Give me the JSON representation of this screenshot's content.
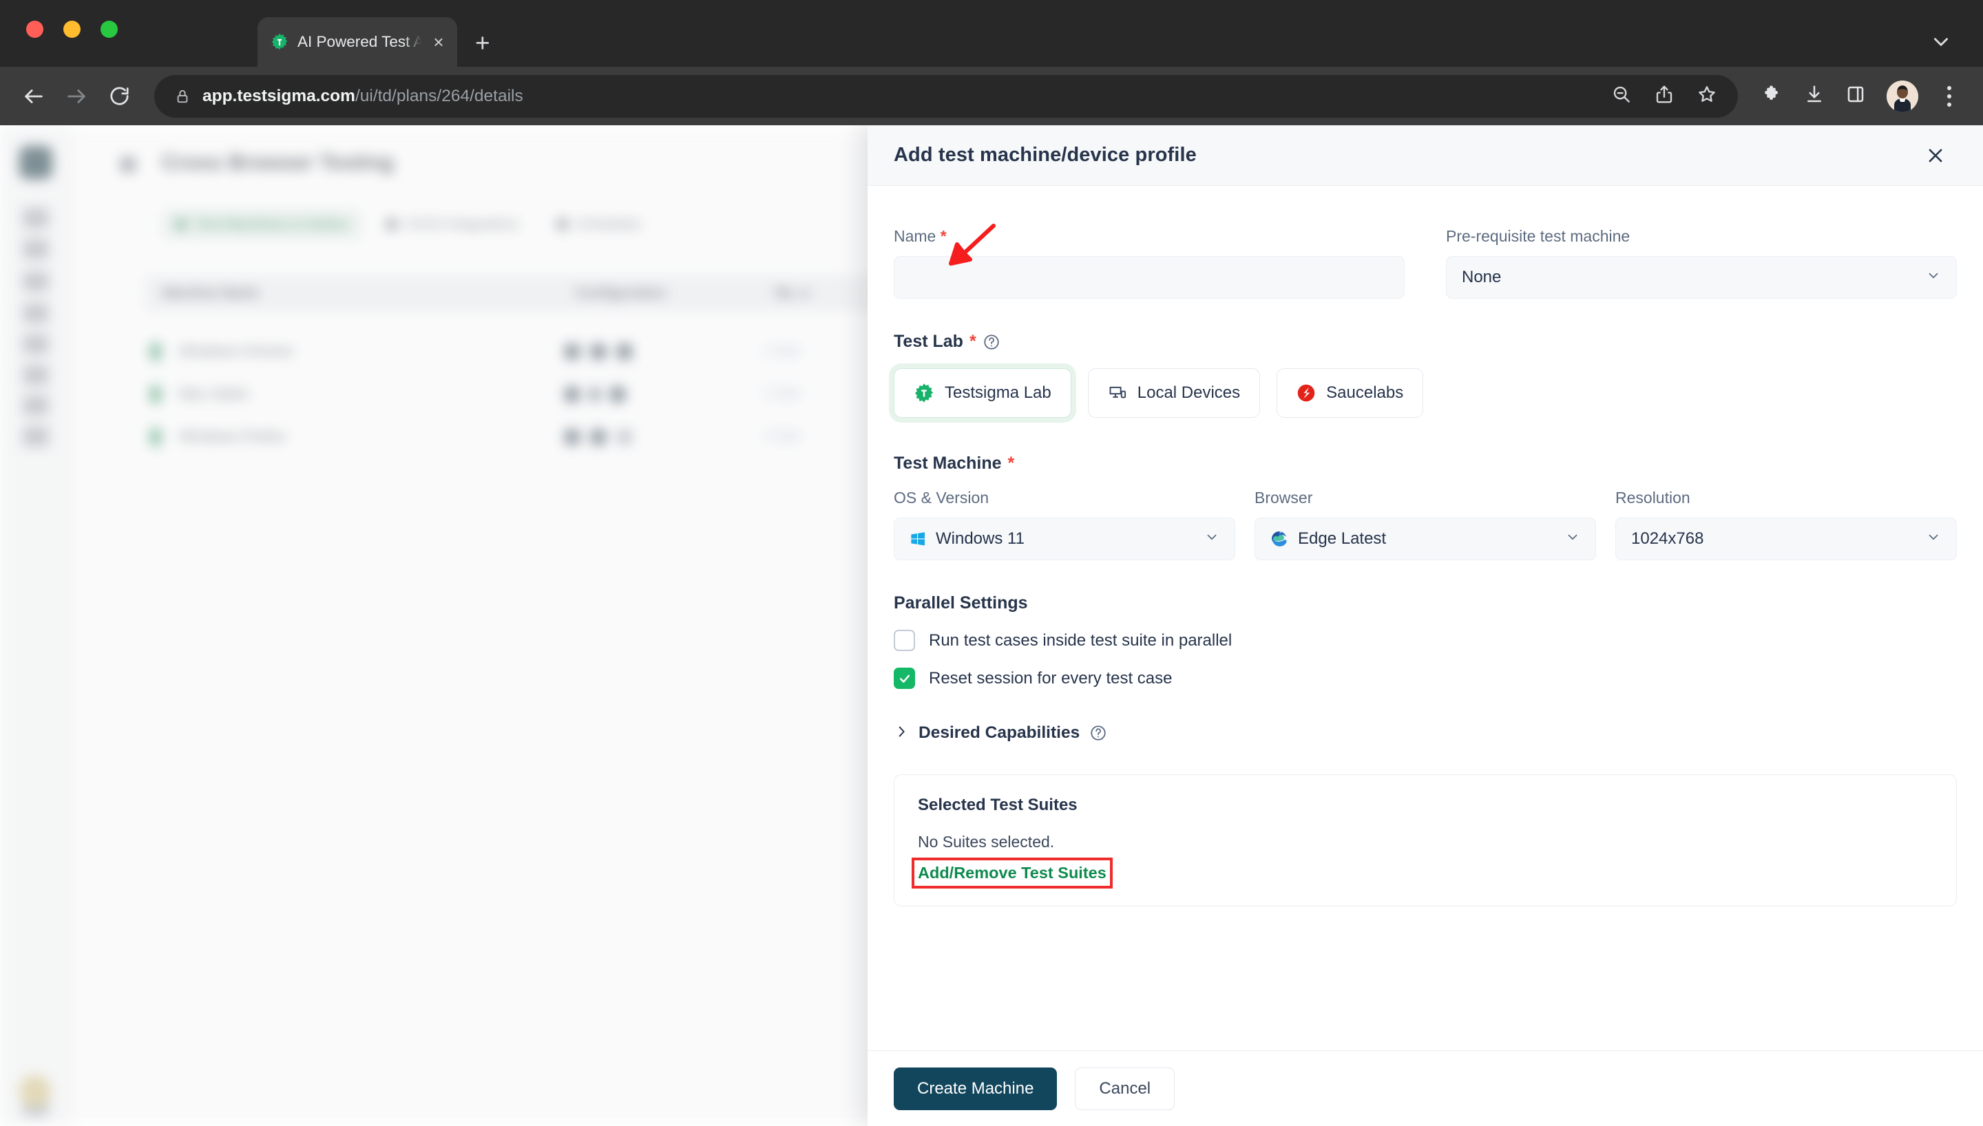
{
  "browser": {
    "tab": {
      "title": "AI Powered Test Automation P",
      "favicon_name": "testsigma-favicon",
      "close_label": "×"
    },
    "new_tab_label": "+",
    "url_host": "app.testsigma.com",
    "url_path": "/ui/td/plans/264/details",
    "icons": {
      "back": "back-arrow-icon",
      "forward": "forward-arrow-icon",
      "reload": "reload-icon",
      "lock": "lock-icon",
      "zoom_out": "zoom-out-icon",
      "share": "share-icon",
      "bookmark": "bookmark-star-icon",
      "extensions": "extensions-puzzle-icon",
      "downloads": "downloads-icon",
      "side_panel": "side-panel-icon",
      "profile": "profile-avatar",
      "menu": "chrome-menu-icon",
      "tab_list": "tab-list-chevron-icon"
    }
  },
  "background_page": {
    "title": "Cross Browser Testing",
    "tabs": [
      {
        "label": "Test Machines & Suites",
        "active": true
      },
      {
        "label": "CI/CD Integrations",
        "active": false
      },
      {
        "label": "Schedules",
        "active": false
      }
    ],
    "table": {
      "columns": [
        "Machine Name",
        "Configuration",
        "No. o"
      ],
      "rows": [
        {
          "name": "Windows Chrome",
          "suites": "2 Suit"
        },
        {
          "name": "Mac Safari",
          "suites": "2 Suit"
        },
        {
          "name": "Windows Firefox",
          "suites": "2 Suit"
        }
      ]
    }
  },
  "panel": {
    "title": "Add test machine/device profile",
    "close_icon": "close-icon",
    "name_field": {
      "label": "Name",
      "required": "*",
      "value": "",
      "placeholder": ""
    },
    "prerequisite_field": {
      "label": "Pre-requisite test machine",
      "value": "None"
    },
    "test_lab": {
      "label": "Test Lab",
      "required": "*",
      "help_icon": "help-circle-icon",
      "options": [
        {
          "label": "Testsigma Lab",
          "icon": "testsigma-gear-icon",
          "selected": true
        },
        {
          "label": "Local Devices",
          "icon": "monitor-phone-icon",
          "selected": false
        },
        {
          "label": "Saucelabs",
          "icon": "saucelabs-icon",
          "selected": false
        }
      ]
    },
    "test_machine": {
      "label": "Test Machine",
      "required": "*",
      "fields": [
        {
          "label": "OS & Version",
          "value": "Windows 11",
          "icon": "windows-logo-icon"
        },
        {
          "label": "Browser",
          "value": "Edge Latest",
          "icon": "edge-logo-icon"
        },
        {
          "label": "Resolution",
          "value": "1024x768",
          "icon": ""
        }
      ]
    },
    "parallel_settings": {
      "label": "Parallel Settings",
      "checkboxes": [
        {
          "label": "Run test cases inside test suite in parallel",
          "checked": false
        },
        {
          "label": "Reset session for every test case",
          "checked": true
        }
      ]
    },
    "desired_capabilities": {
      "label": "Desired Capabilities",
      "expand_icon": "chevron-right-icon",
      "help_icon": "help-circle-icon",
      "expanded": false
    },
    "selected_test_suites": {
      "heading": "Selected Test Suites",
      "empty_text": "No Suites selected.",
      "link_label": "Add/Remove Test Suites"
    },
    "footer": {
      "primary_label": "Create Machine",
      "secondary_label": "Cancel"
    }
  },
  "annotations": {
    "arrow_color": "#f51d1d",
    "highlight_color": "#ef2b2b"
  },
  "colors": {
    "brand_green": "#14b866",
    "link_green": "#0e8a4e",
    "primary_dark": "#12465c",
    "required_red": "#f04438",
    "panel_header_bg": "#f6f8fa"
  }
}
